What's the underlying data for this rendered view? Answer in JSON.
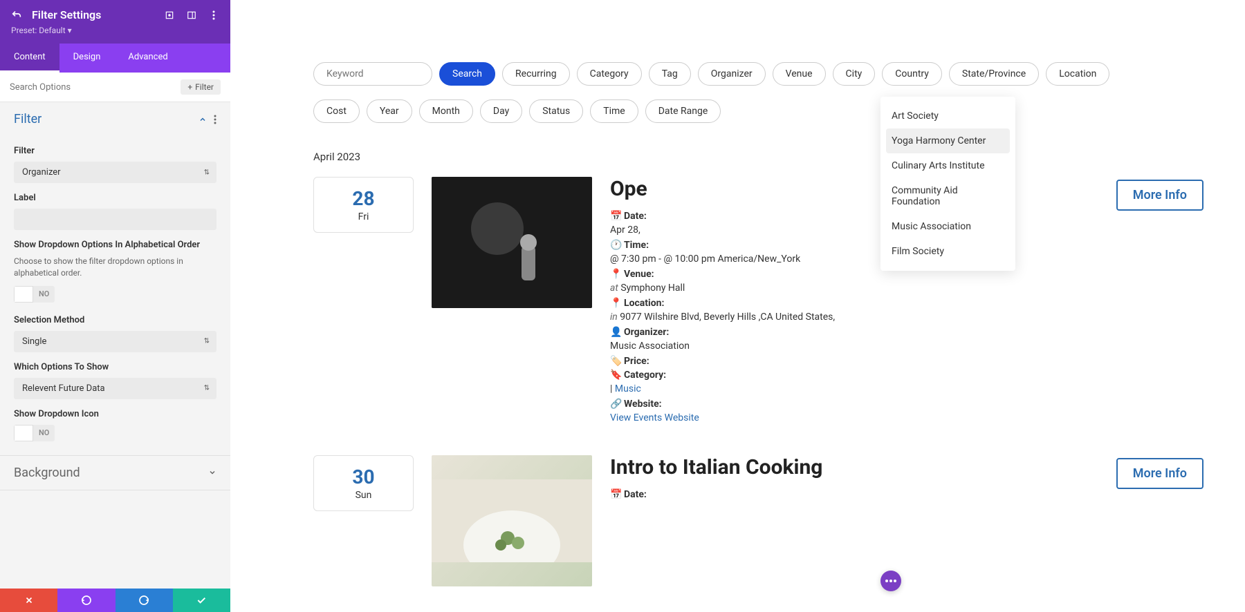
{
  "sidebar": {
    "title": "Filter Settings",
    "preset": "Preset: Default",
    "tabs": [
      "Content",
      "Design",
      "Advanced"
    ],
    "search_placeholder": "Search Options",
    "add_filter": "Filter",
    "sections": {
      "filter": {
        "title": "Filter",
        "filter_label": "Filter",
        "filter_value": "Organizer",
        "label_label": "Label",
        "label_value": "",
        "alpha_label": "Show Dropdown Options In Alphabetical Order",
        "alpha_desc": "Choose to show the filter dropdown options in alphabetical order.",
        "alpha_toggle": "NO",
        "selection_label": "Selection Method",
        "selection_value": "Single",
        "which_label": "Which Options To Show",
        "which_value": "Relevent Future Data",
        "icon_label": "Show Dropdown Icon",
        "icon_toggle": "NO"
      },
      "background": {
        "title": "Background"
      }
    }
  },
  "main": {
    "keyword_placeholder": "Keyword",
    "chips_row1": [
      "Search",
      "Recurring",
      "Category",
      "Tag",
      "Organizer",
      "Venue",
      "City",
      "Country",
      "State/Province",
      "Location"
    ],
    "chips_row2": [
      "Cost",
      "Year",
      "Month",
      "Day",
      "Status",
      "Time",
      "Date Range"
    ],
    "dropdown": [
      "Art Society",
      "Yoga Harmony Center",
      "Culinary Arts Institute",
      "Community Aid Foundation",
      "Music Association",
      "Film Society"
    ],
    "month_header": "April 2023",
    "events": [
      {
        "date_num": "28",
        "date_day": "Fri",
        "title": "Ope",
        "more_info": "More Info",
        "date_lbl": "Date:",
        "date_val": "Apr 28,",
        "time_lbl": "Time:",
        "time_val": "@ 7:30 pm - @ 10:00 pm America/New_York",
        "venue_lbl": "Venue:",
        "venue_prefix": "at",
        "venue_val": "Symphony Hall",
        "loc_lbl": "Location:",
        "loc_prefix": "in",
        "loc_val": "9077 Wilshire Blvd, Beverly Hills ,CA United States,",
        "org_lbl": "Organizer:",
        "org_val": "Music Association",
        "price_lbl": "Price:",
        "cat_lbl": "Category:",
        "cat_prefix": "|",
        "cat_val": "Music",
        "web_lbl": "Website:",
        "web_val": "View Events Website"
      },
      {
        "date_num": "30",
        "date_day": "Sun",
        "title": "Intro to Italian Cooking",
        "more_info": "More Info",
        "date_lbl": "Date:"
      }
    ]
  }
}
